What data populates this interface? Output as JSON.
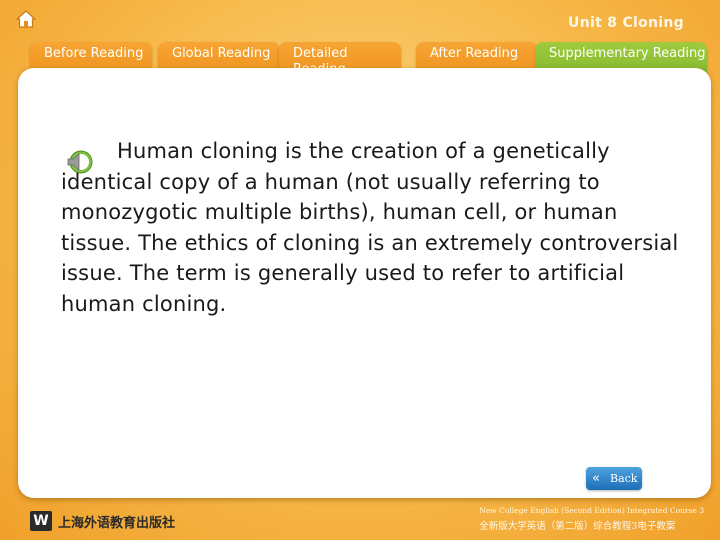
{
  "header": {
    "home_icon": "home-icon",
    "unit_title": "Unit 8 Cloning"
  },
  "tabs": [
    {
      "label": "Before Reading",
      "active": false
    },
    {
      "label": "Global Reading",
      "active": false
    },
    {
      "label": "Detailed Reading",
      "active": false
    },
    {
      "label": "After Reading",
      "active": false
    },
    {
      "label": "Supplementary Reading",
      "active": true
    }
  ],
  "content": {
    "speaker_icon": "speaker-icon",
    "text": "Human cloning is the creation of a genetically identical copy of a human (not usually referring to monozygotic multiple births), human cell, or human tissue. The ethics of cloning is an extremely controversial issue. The term is generally used to refer to artificial human cloning."
  },
  "back_button": {
    "icon": "double-chevron-left-icon",
    "label": "Back"
  },
  "publisher": {
    "logo": "W",
    "name": "上海外语教育出版社"
  },
  "footer": {
    "english": "New College English (Second Edition) Integrated Course 3",
    "chinese": "全新版大学英语（第二版）综合教程3电子教案"
  },
  "colors": {
    "background": "#f7b94a",
    "tab": "#ef8f1a",
    "tab_active": "#8ec035",
    "back_button": "#2f86cc"
  }
}
